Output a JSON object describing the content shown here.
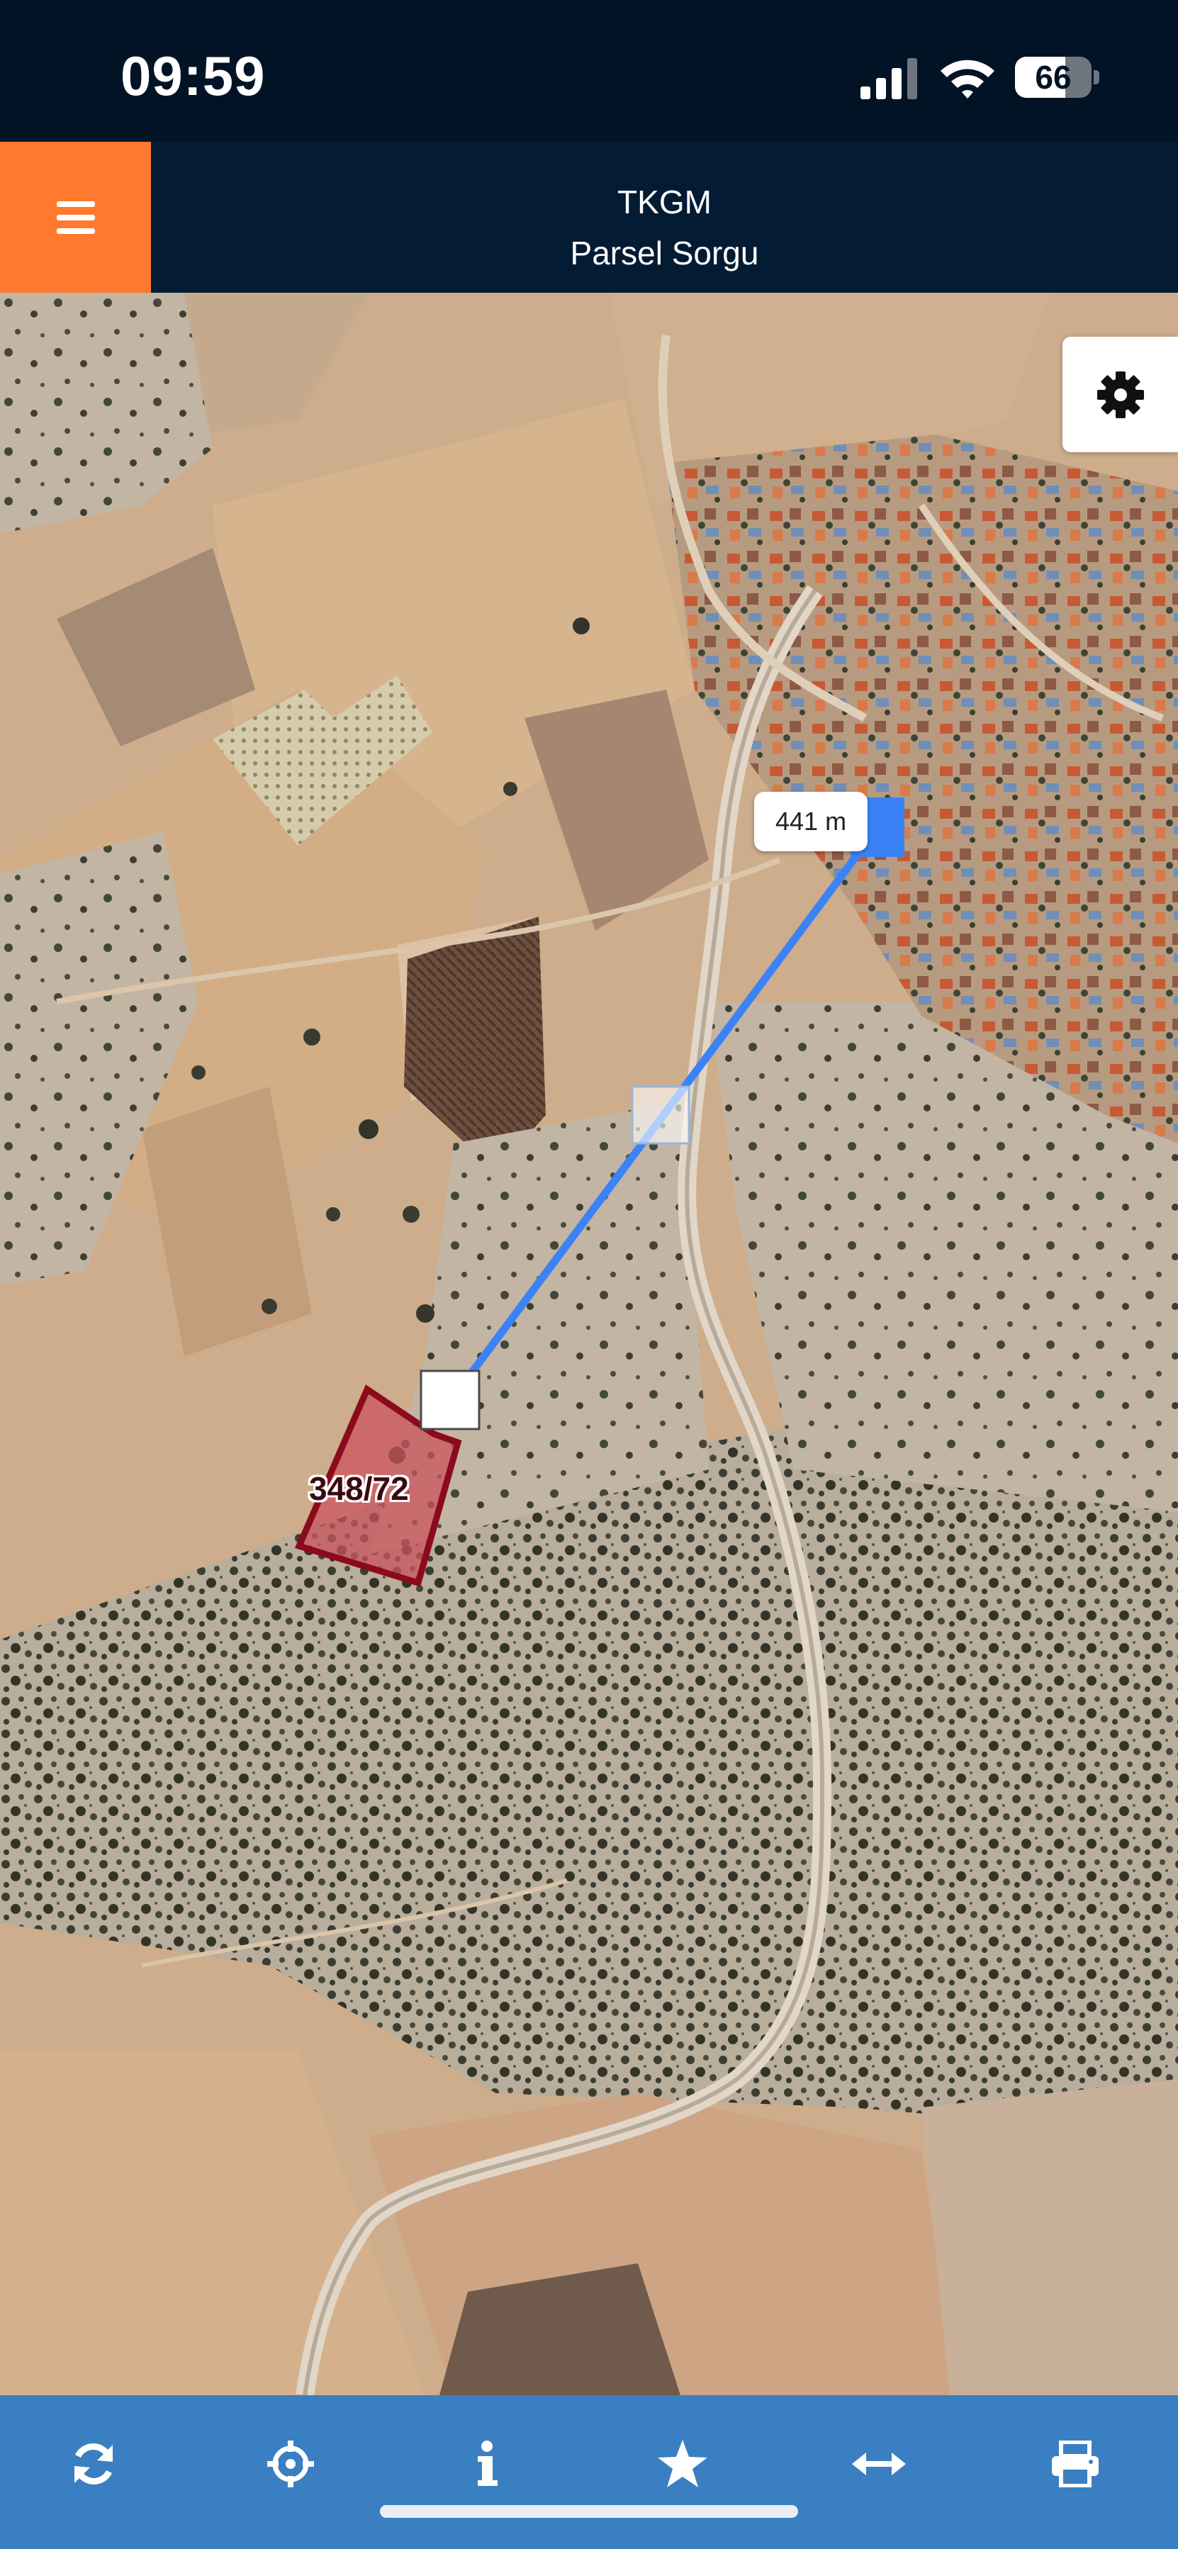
{
  "status_bar": {
    "time": "09:59",
    "battery_percent": 66,
    "battery_label": "66",
    "signal_icon": "cellular-signal-icon",
    "wifi_icon": "wifi-icon"
  },
  "header": {
    "title": "TKGM",
    "subtitle": "Parsel Sorgu",
    "menu_icon": "hamburger-menu-icon",
    "accent_color": "#ff7a2f",
    "background_color": "#041b34"
  },
  "map": {
    "settings_icon": "gear-icon",
    "measurement": {
      "distance_label": "441 m",
      "line_color": "#3b82f6"
    },
    "parcel": {
      "label": "348/72",
      "outline_color": "#8b0a1e"
    }
  },
  "toolbar": {
    "background_color": "#3a7fc1",
    "buttons": [
      {
        "icon": "refresh-icon"
      },
      {
        "icon": "locate-crosshair-icon"
      },
      {
        "icon": "info-icon"
      },
      {
        "icon": "star-icon"
      },
      {
        "icon": "measure-distance-icon"
      },
      {
        "icon": "print-icon"
      }
    ]
  }
}
